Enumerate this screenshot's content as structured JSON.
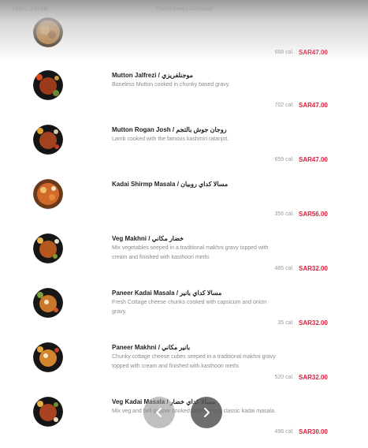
{
  "status_bar": {
    "time": "10/8/21, 2:12 AM",
    "title": "Fireline Panel | Dashboard"
  },
  "menu": [
    {
      "name": "",
      "description": "",
      "calories": "668 cal.",
      "price": "SAR47.00"
    },
    {
      "name": "Mutton Jalfrezi / موجنلفريزي",
      "description": "Boneless Mutton cooked in chunky based gravy.",
      "calories": "702 cal.",
      "price": "SAR47.00"
    },
    {
      "name": "Mutton Rogan Josh / روجان جوش بالتجم",
      "description": "Lamb cooked with the famous kashmiri ratanjot.",
      "calories": "659 cal.",
      "price": "SAR47.00"
    },
    {
      "name": "Kadai Shirmp Masala / مسالا كداي روبيان",
      "description": "",
      "calories": "356 cal.",
      "price": "SAR56.00"
    },
    {
      "name": "Veg Makhni / خضار مكاني",
      "description": "Mix vegetables seeped in a traditional makhni gravy topped with cream and finished with kasthoori methi.",
      "calories": "485 cal.",
      "price": "SAR32.00"
    },
    {
      "name": "Paneer Kadai Masala / مسالا كداي بانير",
      "description": "Fresh Cottage cheese chunks cooked with capsicum and onion gravy.",
      "calories": "35 cal.",
      "price": "SAR32.00"
    },
    {
      "name": "Paneer Makhni / بانير مكاني",
      "description": "Chunky cottage cheese cubes seeped in a traditional makhni gravy topped with cream and finished with kasthoori methi.",
      "calories": "520 cal.",
      "price": "SAR32.00"
    },
    {
      "name": "Veg Kadai Masala / مسالا كداي خضار",
      "description": "Mix veg and bell pepper cooked together in a classic kadai masala.",
      "calories": "496 cal.",
      "price": "SAR30.00"
    }
  ],
  "carousel": {
    "prev_icon": "chevron-left-icon",
    "next_icon": "chevron-right-icon"
  }
}
